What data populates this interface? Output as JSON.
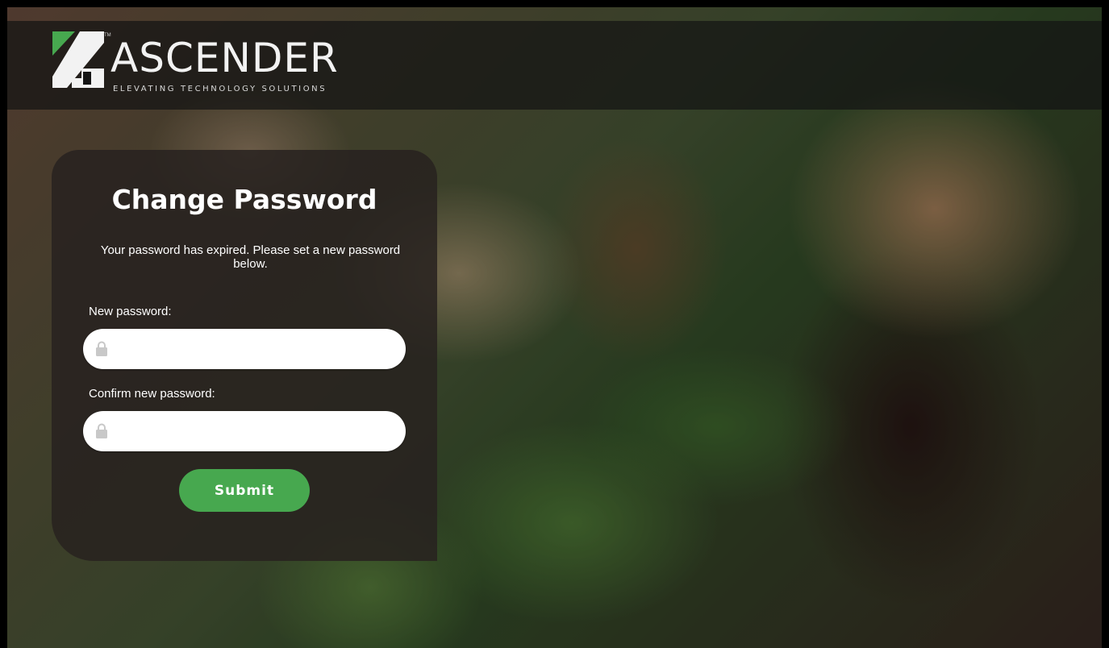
{
  "brand": {
    "name": "ASCENDER",
    "tagline": "ELEVATING TECHNOLOGY SOLUTIONS",
    "trademark": "TM"
  },
  "form": {
    "title": "Change Password",
    "message": "Your password has expired. Please set a new password below.",
    "new_password_label": "New password:",
    "new_password_value": "",
    "confirm_password_label": "Confirm new password:",
    "confirm_password_value": "",
    "submit_label": "Submit",
    "lock_icon": "lock-icon"
  },
  "colors": {
    "brand_green": "#47a84f",
    "logo_white": "#f2f2f2",
    "card_bg": "#28221f",
    "header_bg": "#141414"
  }
}
